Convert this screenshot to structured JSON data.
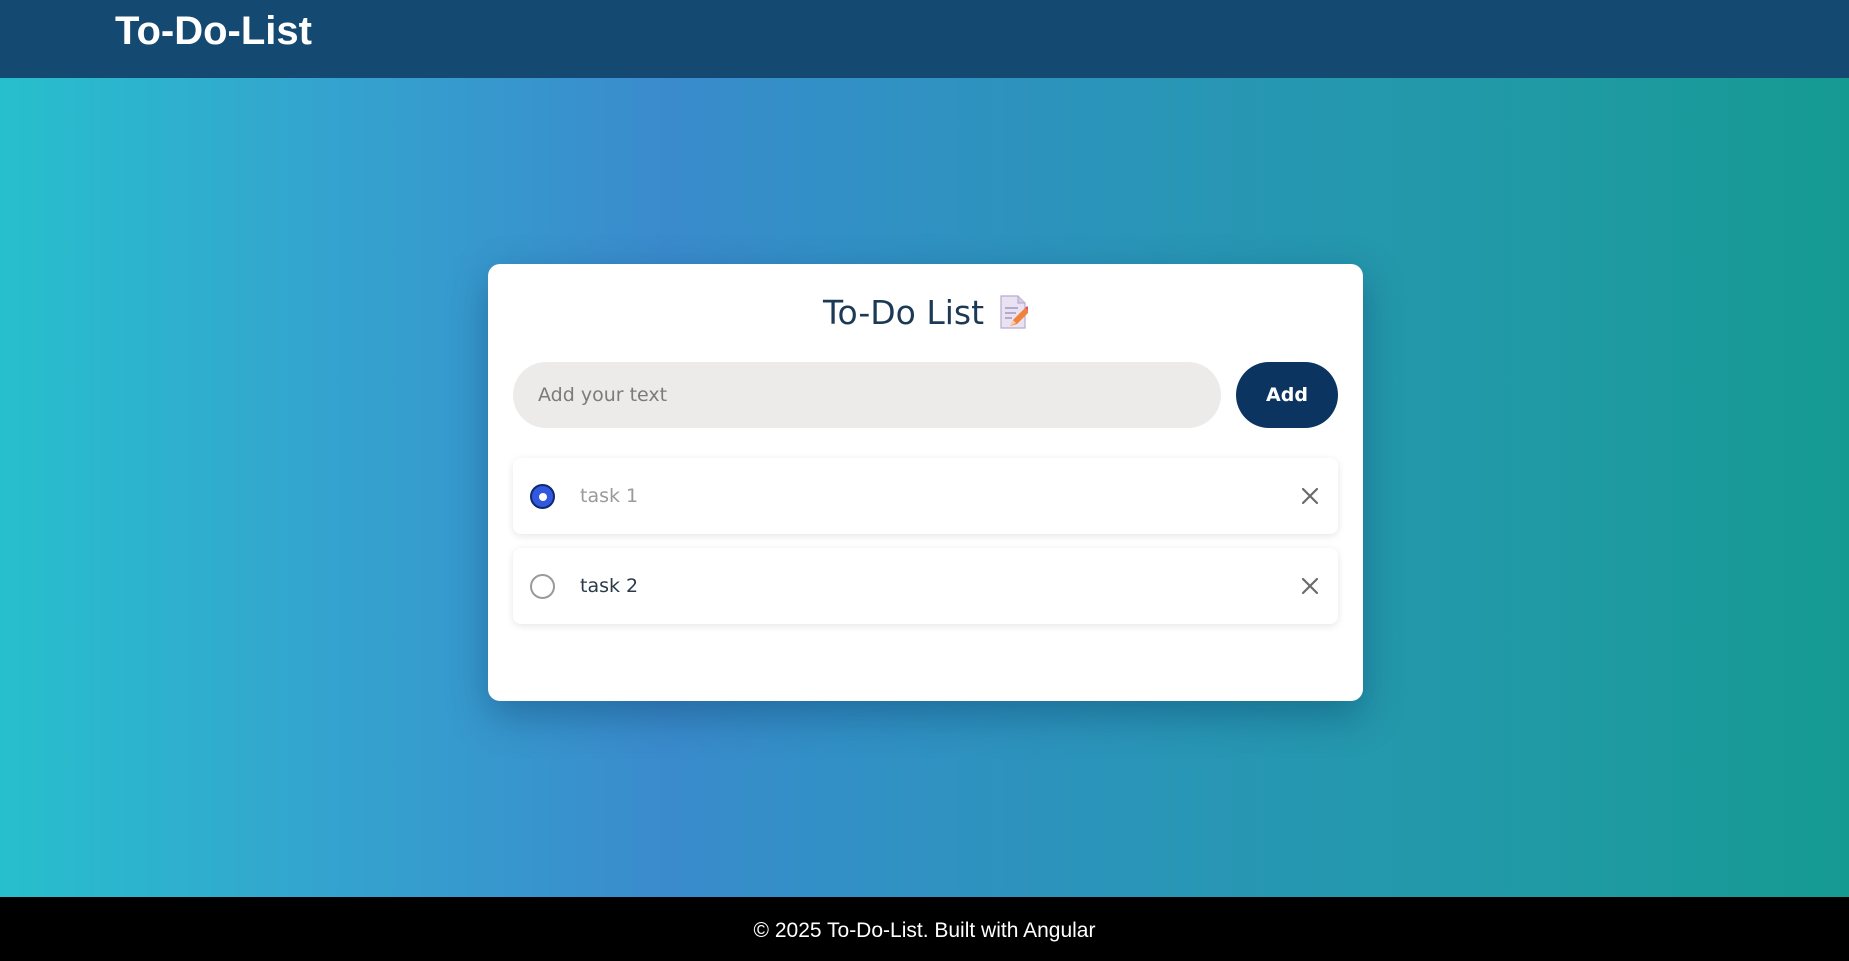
{
  "header": {
    "brand": "To-Do-List"
  },
  "card": {
    "title": "To-Do List",
    "title_icon": "memo-pencil-icon",
    "input": {
      "value": "",
      "placeholder": "Add your text"
    },
    "add_label": "Add",
    "tasks": [
      {
        "label": "task 1",
        "completed": true
      },
      {
        "label": "task 2",
        "completed": false
      }
    ],
    "delete_icon": "close-icon"
  },
  "footer": {
    "text": "© 2025 To-Do-List. Built with Angular"
  },
  "colors": {
    "navbar": "#144a72",
    "accent": "#0c3460",
    "checked_radio": "#3358e0",
    "footer": "#000000"
  }
}
